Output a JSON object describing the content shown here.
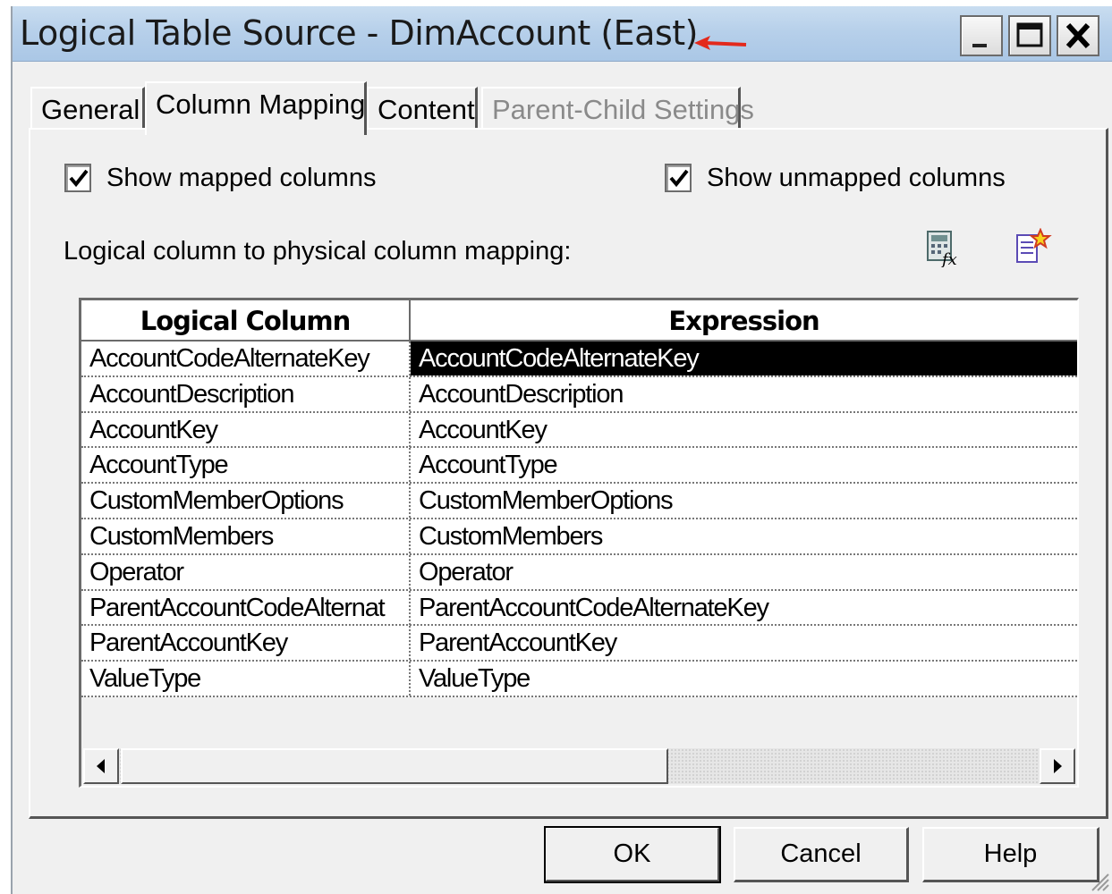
{
  "window": {
    "title": "Logical Table Source - DimAccount (East)"
  },
  "tabs": [
    {
      "label": "General"
    },
    {
      "label": "Column Mapping"
    },
    {
      "label": "Content"
    },
    {
      "label": "Parent-Child Settings"
    }
  ],
  "options": {
    "show_mapped_label": "Show mapped columns",
    "show_mapped_checked": true,
    "show_unmapped_label": "Show unmapped columns",
    "show_unmapped_checked": true
  },
  "mapping": {
    "label": "Logical column to physical column mapping:",
    "headers": {
      "logical": "Logical Column",
      "expression": "Expression"
    },
    "rows": [
      {
        "logical": "AccountCodeAlternateKey",
        "expression": "AccountCodeAlternateKey"
      },
      {
        "logical": "AccountDescription",
        "expression": "AccountDescription"
      },
      {
        "logical": "AccountKey",
        "expression": "AccountKey"
      },
      {
        "logical": "AccountType",
        "expression": "AccountType"
      },
      {
        "logical": "CustomMemberOptions",
        "expression": "CustomMemberOptions"
      },
      {
        "logical": "CustomMembers",
        "expression": "CustomMembers"
      },
      {
        "logical": "Operator",
        "expression": "Operator"
      },
      {
        "logical": "ParentAccountCodeAlternat",
        "expression": "ParentAccountCodeAlternateKey"
      },
      {
        "logical": "ParentAccountKey",
        "expression": "ParentAccountKey"
      },
      {
        "logical": "ValueType",
        "expression": "ValueType"
      }
    ]
  },
  "buttons": {
    "ok": "OK",
    "cancel": "Cancel",
    "help": "Help"
  }
}
